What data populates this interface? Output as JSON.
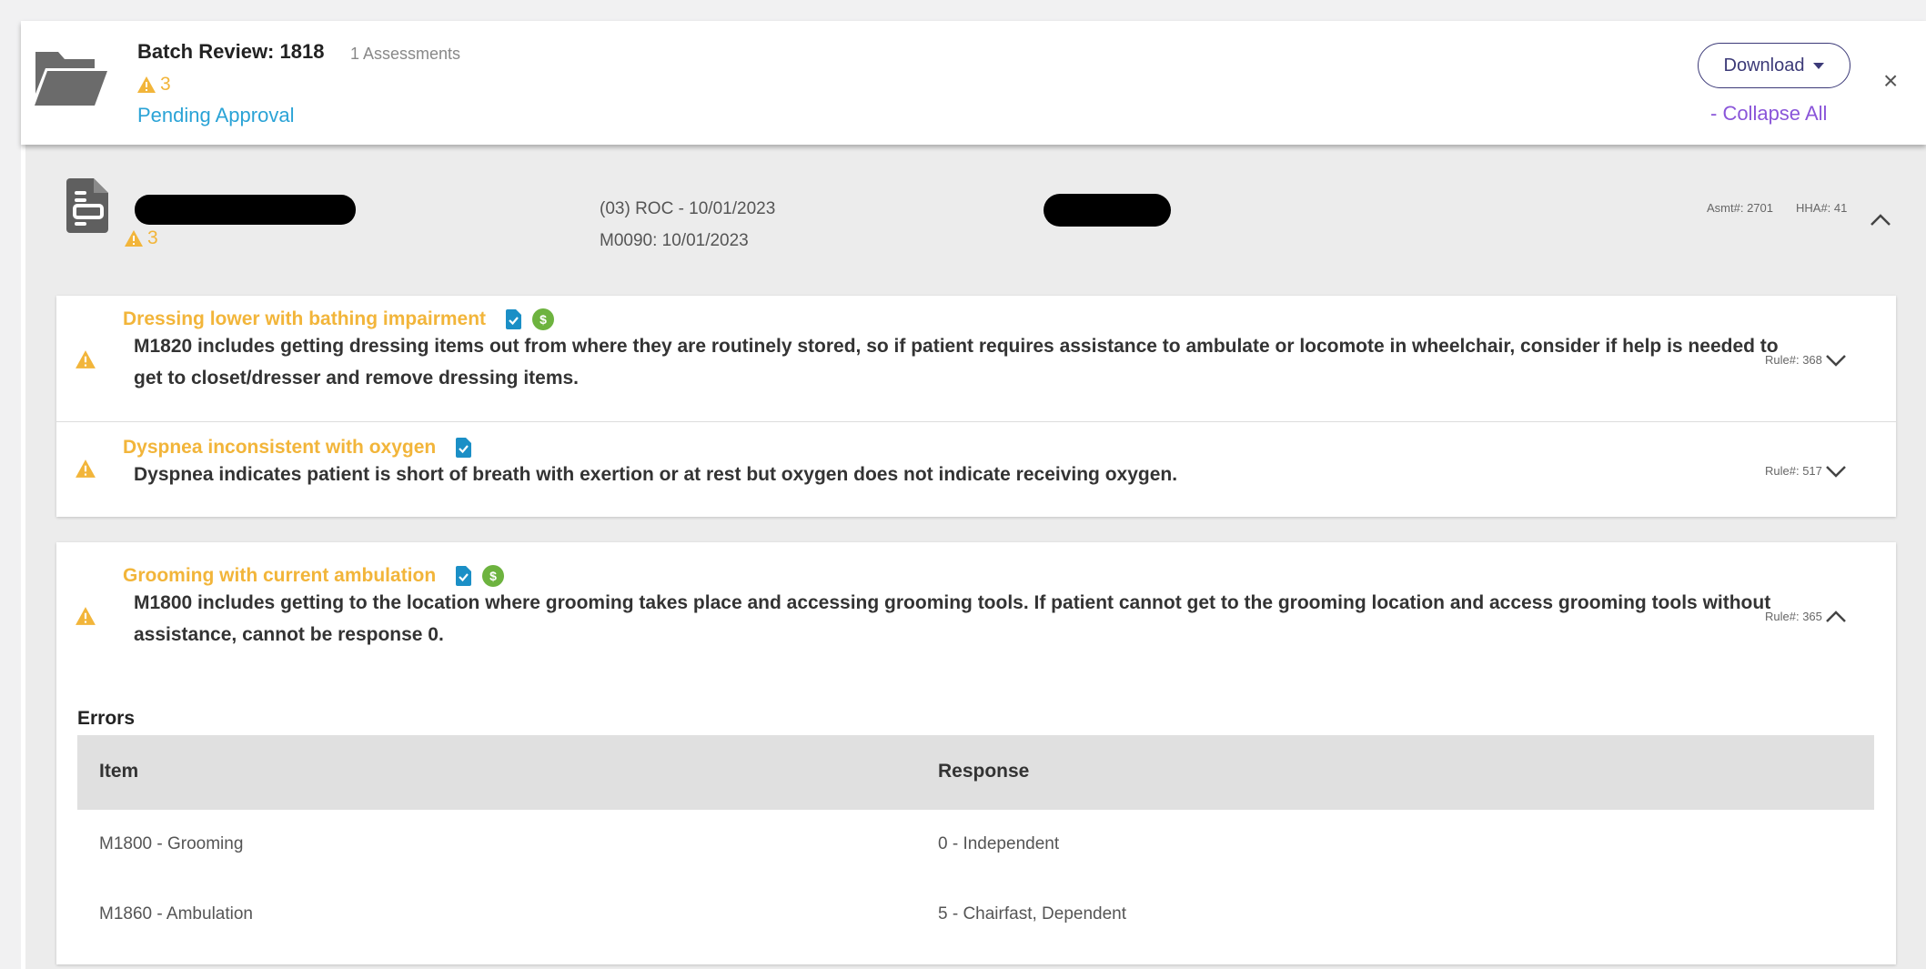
{
  "batch": {
    "title": "Batch Review: 1818",
    "assessments": "1 Assessments",
    "warning_count": "3",
    "status": "Pending Approval",
    "download_label": "Download",
    "collapse_all": "- Collapse All",
    "close": "×"
  },
  "assessment": {
    "warning_count": "3",
    "roc": "(03) ROC - 10/01/2023",
    "m0090": "M0090: 10/01/2023",
    "asmt": "Asmt#: 2701",
    "hha": "HHA#: 41"
  },
  "issues": [
    {
      "title": "Dressing lower with bathing impairment",
      "description": "M1820 includes getting dressing items out from where they are routinely stored, so if patient requires assistance to ambulate or locomote in wheelchair, consider if help is needed to get to closet/dresser and remove dressing items.",
      "rule": "Rule#: 368",
      "icons": [
        "document-check-icon",
        "dollar-icon"
      ],
      "expanded": false
    },
    {
      "title": "Dyspnea inconsistent with oxygen",
      "description": "Dyspnea indicates patient is short of breath with exertion or at rest but oxygen does not indicate receiving oxygen.",
      "rule": "Rule#: 517",
      "icons": [
        "document-check-icon"
      ],
      "expanded": false
    },
    {
      "title": "Grooming with current ambulation",
      "description": "M1800 includes getting to the location where grooming takes place and accessing grooming tools. If patient cannot get to the grooming location and access grooming tools without assistance, cannot be response 0.",
      "rule": "Rule#: 365",
      "icons": [
        "document-check-icon",
        "dollar-icon"
      ],
      "expanded": true,
      "errors": {
        "label": "Errors",
        "headers": [
          "Item",
          "Response"
        ],
        "rows": [
          [
            "M1800 - Grooming",
            "0 - Independent"
          ],
          [
            "M1860 - Ambulation",
            "5 - Chairfast, Dependent"
          ]
        ]
      }
    }
  ],
  "colors": {
    "warning": "#f2b53a",
    "status_link": "#2aa3d6",
    "collapse_link": "#8a55d9",
    "download_border": "#3c3a78",
    "doc_icon": "#1b8fc6",
    "dollar_icon": "#6db33f"
  }
}
